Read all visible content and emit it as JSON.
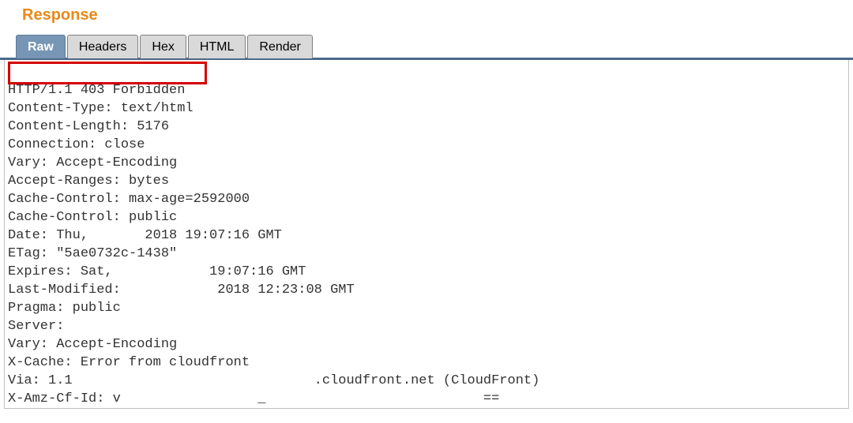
{
  "section_title": "Response",
  "tabs": {
    "raw": "Raw",
    "headers": "Headers",
    "hex": "Hex",
    "html": "HTML",
    "render": "Render"
  },
  "response": {
    "status_line": "HTTP/1.1 403 Forbidden",
    "lines": [
      "Content-Type: text/html",
      "Content-Length: 5176",
      "Connection: close",
      "Vary: Accept-Encoding",
      "Accept-Ranges: bytes",
      "Cache-Control: max-age=2592000",
      "Cache-Control: public",
      "Date: Thu,       2018 19:07:16 GMT",
      "ETag: \"5ae0732c-1438\"",
      "Expires: Sat,            19:07:16 GMT",
      "Last-Modified:            2018 12:23:08 GMT",
      "Pragma: public",
      "Server:",
      "Vary: Accept-Encoding",
      "X-Cache: Error from cloudfront",
      "Via: 1.1                              .cloudfront.net (CloudFront)",
      "X-Amz-Cf-Id: v                 _                           =="
    ]
  }
}
